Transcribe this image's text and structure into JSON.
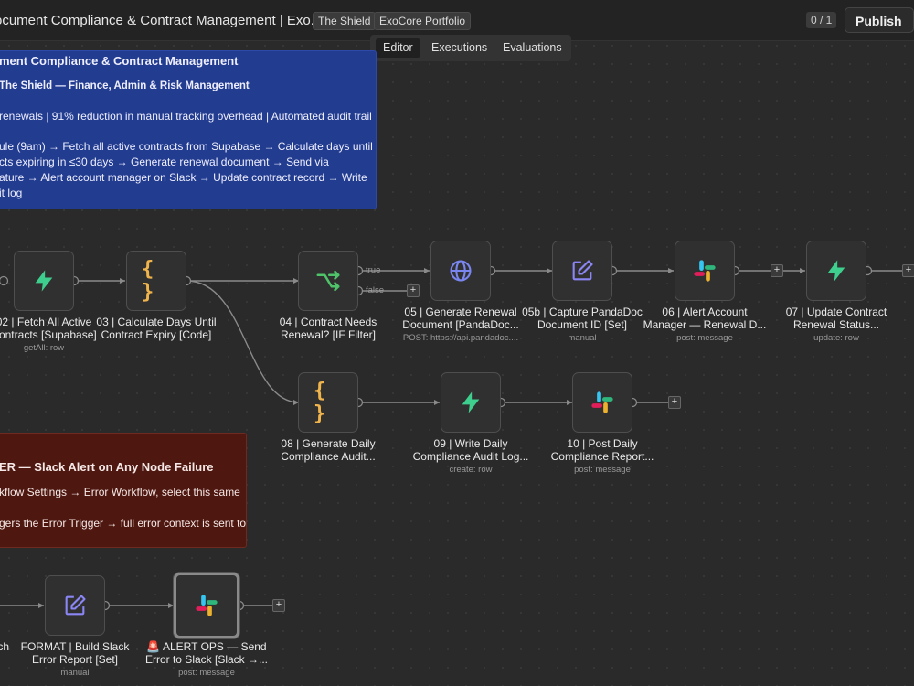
{
  "header": {
    "title": "ocument Compliance & Contract Management | Exo...",
    "tags": [
      "The Shield",
      "ExoCore Portfolio"
    ],
    "counter": "0 / 1",
    "publish_label": "Publish"
  },
  "view_tabs": [
    "Editor",
    "Executions",
    "Evaluations"
  ],
  "sticky_main": {
    "lines": [
      "ment Compliance & Contract Management",
      "The Shield — Finance, Admin & Risk Management",
      "renewals | 91% reduction in manual tracking overhead | Automated audit trail",
      "ule (9am) → Fetch all active contracts from Supabase → Calculate days until",
      "cts expiring in ≤30 days → Generate renewal document → Send via",
      "ature → Alert account manager on Slack → Update contract record → Write",
      "it log"
    ]
  },
  "sticky_error": {
    "lines": [
      "ER — Slack Alert on Any Node Failure",
      "kflow Settings → Error Workflow, select this same",
      "gers the Error Trigger → full error context is sent to"
    ]
  },
  "nodes": [
    {
      "id": "n02",
      "icon": "bolt-icon",
      "label": "02 | Fetch All Active",
      "label2": "Contracts [Supabase]",
      "sub": "getAll: row"
    },
    {
      "id": "n03",
      "icon": "braces-icon",
      "label": "03 | Calculate Days Until",
      "label2": "Contract Expiry [Code]",
      "sub": ""
    },
    {
      "id": "n04",
      "icon": "branch-icon",
      "label": "04 | Contract Needs",
      "label2": "Renewal? [IF Filter]",
      "sub": ""
    },
    {
      "id": "n05",
      "icon": "globe-icon",
      "label": "05 | Generate Renewal",
      "label2": "Document [PandaDoc...",
      "sub": "POST: https://api.pandadoc...."
    },
    {
      "id": "n05b",
      "icon": "pencil-icon",
      "label": "05b | Capture PandaDoc",
      "label2": "Document ID [Set]",
      "sub": "manual"
    },
    {
      "id": "n06",
      "icon": "slack-icon",
      "label": "06 | Alert Account",
      "label2": "Manager — Renewal D...",
      "sub": "post: message"
    },
    {
      "id": "n07",
      "icon": "bolt-icon",
      "label": "07 | Update Contract",
      "label2": "Renewal Status...",
      "sub": "update: row"
    },
    {
      "id": "n08",
      "icon": "braces-icon",
      "label": "08 | Generate Daily",
      "label2": "Compliance Audit...",
      "sub": ""
    },
    {
      "id": "n09",
      "icon": "bolt-icon",
      "label": "09 | Write Daily",
      "label2": "Compliance Audit Log...",
      "sub": "create: row"
    },
    {
      "id": "n10",
      "icon": "slack-icon",
      "label": "10 | Post Daily",
      "label2": "Compliance Report...",
      "sub": "post: message"
    },
    {
      "id": "nformat",
      "icon": "pencil-icon",
      "label": "FORMAT | Build Slack",
      "label2": "Error Report [Set]",
      "sub": "manual"
    },
    {
      "id": "nalert",
      "icon": "slack-icon",
      "label": "🚨 ALERT OPS — Send",
      "label2": "Error to Slack [Slack →...",
      "sub": "post: message"
    }
  ],
  "partial_label": "ch",
  "branch_labels": {
    "true": "true",
    "false": "false"
  },
  "colors": {
    "bolt": "#3ecf8e",
    "braces": "#f0b44c",
    "branch": "#4fc36a",
    "globe": "#7a86f0",
    "pencil": "#8b86f5",
    "sticky_blue": "#223c8f",
    "sticky_red": "#4e1710"
  }
}
